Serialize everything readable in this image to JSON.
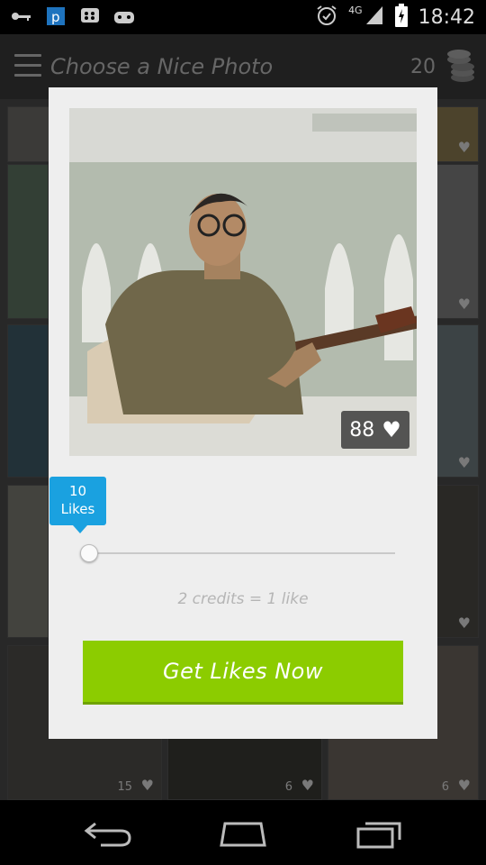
{
  "status_bar": {
    "time": "18:42",
    "network": "4G",
    "icons": [
      "key-icon",
      "p-app-icon",
      "bbm-icon",
      "game-icon",
      "alarm-icon",
      "signal-icon",
      "battery-icon"
    ]
  },
  "action_bar": {
    "title": "Choose a Nice Photo",
    "credits": "20",
    "icons": [
      "menu-icon",
      "coins-icon"
    ]
  },
  "background_grid": {
    "like_counts": [
      "15",
      "6",
      "6"
    ]
  },
  "dialog": {
    "photo_likes": "88",
    "tooltip_number": "10",
    "tooltip_label": "Likes",
    "slider_value": 10,
    "rate_text": "2 credits = 1 like",
    "button_label": "Get Likes Now"
  },
  "colors": {
    "accent_green": "#8ccc00",
    "tooltip_blue": "#1aa1e0",
    "action_bar": "#3a3a3a"
  }
}
